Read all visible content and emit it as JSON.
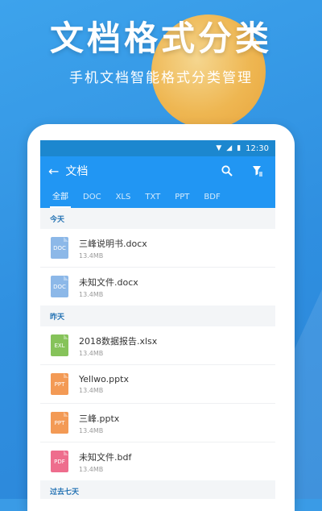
{
  "hero": {
    "title": "文档格式分类",
    "subtitle": "手机文档智能格式分类管理"
  },
  "status_bar": {
    "time": "12:30"
  },
  "app_bar": {
    "title": "文档"
  },
  "tabs": [
    {
      "label": "全部",
      "active": true
    },
    {
      "label": "DOC",
      "active": false
    },
    {
      "label": "XLS",
      "active": false
    },
    {
      "label": "TXT",
      "active": false
    },
    {
      "label": "PPT",
      "active": false
    },
    {
      "label": "BDF",
      "active": false
    }
  ],
  "sections": [
    {
      "header": "今天",
      "files": [
        {
          "icon_label": "DOC",
          "icon_color": "#8cb8e8",
          "name": "三峰说明书.docx",
          "size": "13.4MB"
        },
        {
          "icon_label": "DOC",
          "icon_color": "#8cb8e8",
          "name": "未知文件.docx",
          "size": "13.4MB"
        }
      ]
    },
    {
      "header": "昨天",
      "files": [
        {
          "icon_label": "EXL",
          "icon_color": "#86c35a",
          "name": "2018数据报告.xlsx",
          "size": "13.4MB"
        },
        {
          "icon_label": "PPT",
          "icon_color": "#f39a55",
          "name": "Yellwo.pptx",
          "size": "13.4MB"
        },
        {
          "icon_label": "PPT",
          "icon_color": "#f39a55",
          "name": "三峰.pptx",
          "size": "13.4MB"
        },
        {
          "icon_label": "PDF",
          "icon_color": "#ee6d8d",
          "name": "未知文件.bdf",
          "size": "13.4MB"
        }
      ]
    },
    {
      "header": "过去七天",
      "files": []
    }
  ],
  "colors": {
    "accent": "#2196f3",
    "status_bar": "#1c87cf",
    "background": "#3a9be6",
    "sun": "#f8b84a"
  },
  "icons": {
    "back": "arrow-left-icon",
    "search": "search-icon",
    "filter": "filter-icon"
  }
}
